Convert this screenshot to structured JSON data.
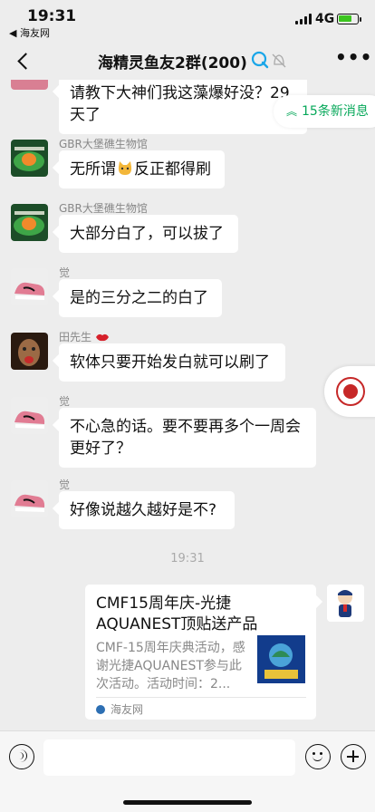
{
  "status_bar": {
    "time": "19:31",
    "back_app": "◀ 海友网",
    "network": "4G"
  },
  "header": {
    "title": "海精灵鱼友2群(200)",
    "more": "•••"
  },
  "new_messages": {
    "label": "15条新消息"
  },
  "messages": [
    {
      "sender": "",
      "text": "请教下大神们我这藻爆好没？29天了"
    },
    {
      "sender": "GBR大堡礁生物馆",
      "text_before": "无所谓",
      "text_after": "反正都得刷"
    },
    {
      "sender": "GBR大堡礁生物馆",
      "text": "大部分白了，可以拔了"
    },
    {
      "sender": "觉",
      "text": "是的三分之二的白了"
    },
    {
      "sender": "田先生",
      "text": "软体只要开始发白就可以刷了"
    },
    {
      "sender": "觉",
      "text": "不心急的话。要不要再多个一周会更好了？"
    },
    {
      "sender": "觉",
      "text": "好像说越久越好是不?"
    }
  ],
  "time_divider": "19:31",
  "shared_card": {
    "title": "CMF15周年庆-光捷AQUANEST顶贴送产品",
    "description": "CMF-15周年庆典活动，感谢光捷AQUANEST参与此次活动。活动时间：2...",
    "source": "海友网"
  },
  "colors": {
    "accent": "#07a85a",
    "background": "#ededed",
    "bubble": "#ffffff"
  }
}
